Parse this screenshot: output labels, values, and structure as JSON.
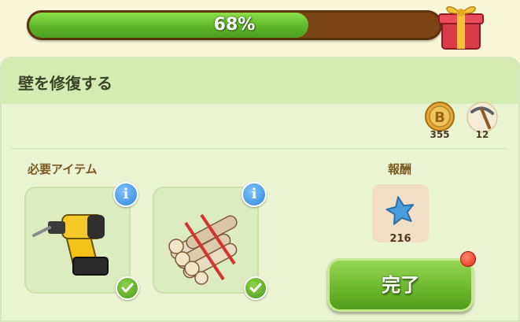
{
  "progress": {
    "percent_text": "68%",
    "fraction": 0.68
  },
  "panel": {
    "title": "壁を修復する"
  },
  "resources": [
    {
      "icon": "coin-b-icon",
      "value": "355"
    },
    {
      "icon": "pickaxe-icon",
      "value": "12"
    }
  ],
  "required": {
    "label": "必要アイテム",
    "items": [
      {
        "icon": "drill-icon",
        "status": "check"
      },
      {
        "icon": "wood-logs-icon",
        "status": "check"
      }
    ]
  },
  "reward": {
    "label": "報酬",
    "icon": "blue-star-icon",
    "value": "216"
  },
  "done_button": {
    "label": "完了"
  }
}
